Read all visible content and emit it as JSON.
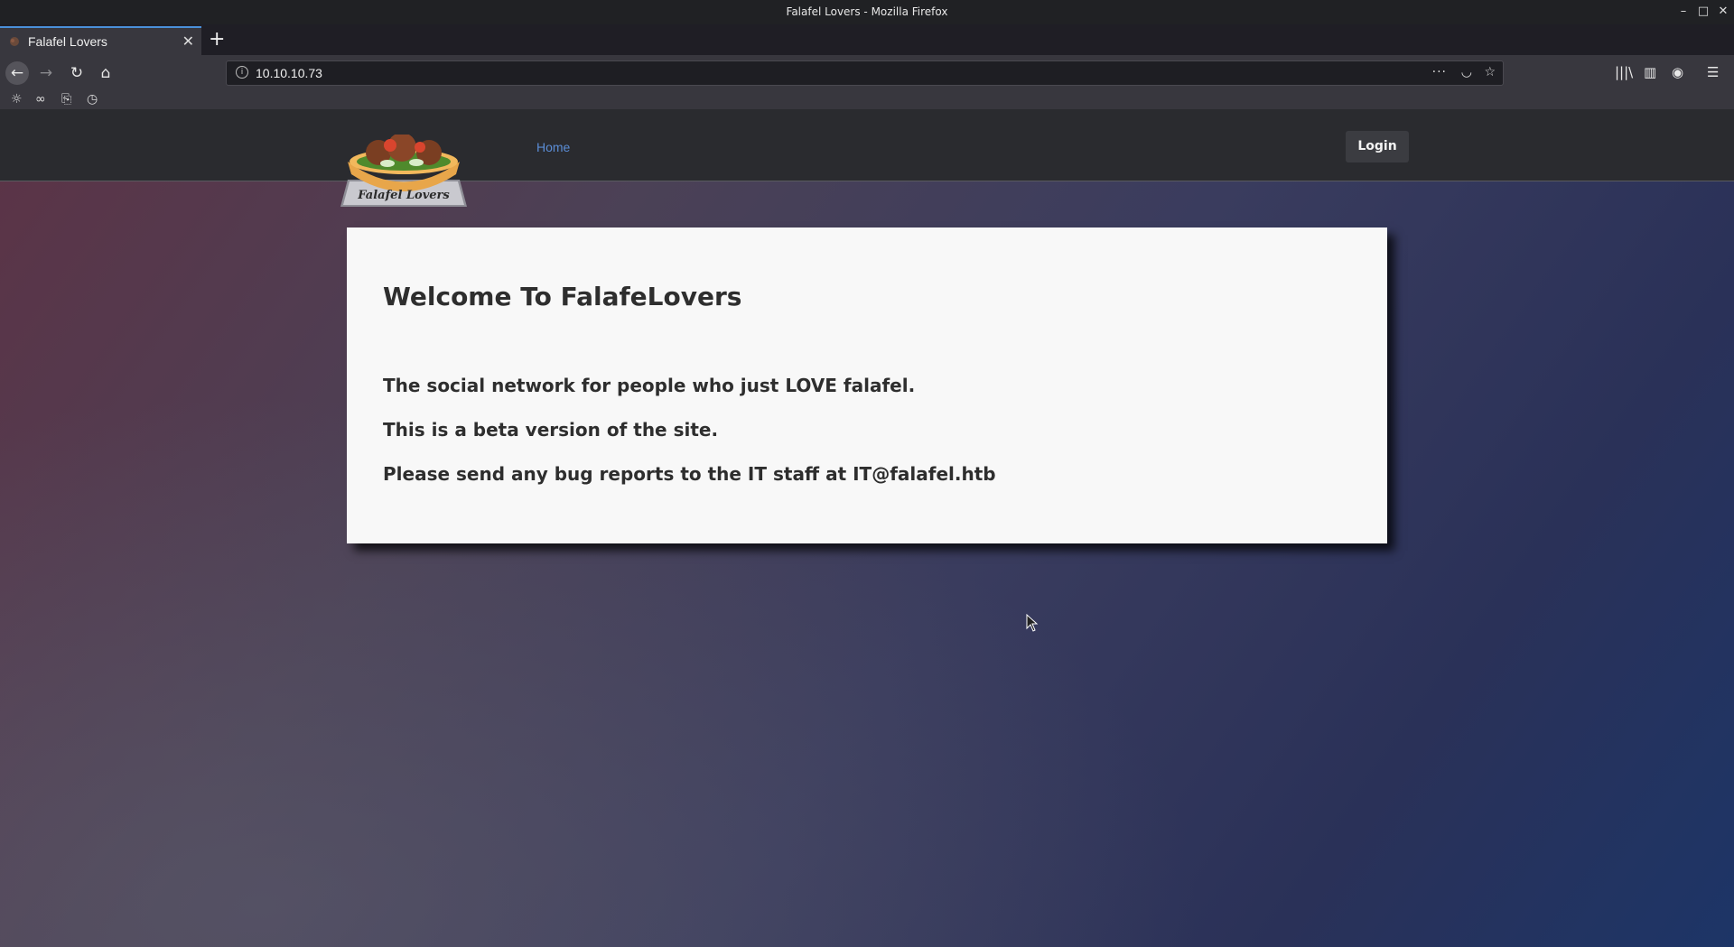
{
  "window": {
    "title": "Falafel Lovers - Mozilla Firefox",
    "min": "–",
    "max": "□",
    "close": "✕"
  },
  "tab": {
    "title": "Falafel Lovers",
    "close": "✕",
    "new": "+"
  },
  "navbar": {
    "back": "←",
    "forward": "→",
    "reload": "↻",
    "home": "⌂",
    "url": "10.10.10.73",
    "info": "i",
    "more": "···",
    "pocket": "◡",
    "star": "☆",
    "library": "|||\\",
    "sidebar": "▥",
    "account": "◉",
    "menu": "☰"
  },
  "bookmarks": [
    "☼",
    "∞",
    "⎘",
    "◷"
  ],
  "site": {
    "logo_text": "Falafel Lovers",
    "nav_home": "Home",
    "login": "Login"
  },
  "content": {
    "heading": "Welcome To FalafeLovers",
    "lines": [
      "The social network for people who just LOVE falafel.",
      "This is a beta version of the site.",
      "Please send any bug reports to the IT staff at IT@falafel.htb"
    ]
  },
  "colors": {
    "accent": "#4a90d9",
    "link": "#5b8dd6",
    "card": "#f8f8f8"
  }
}
